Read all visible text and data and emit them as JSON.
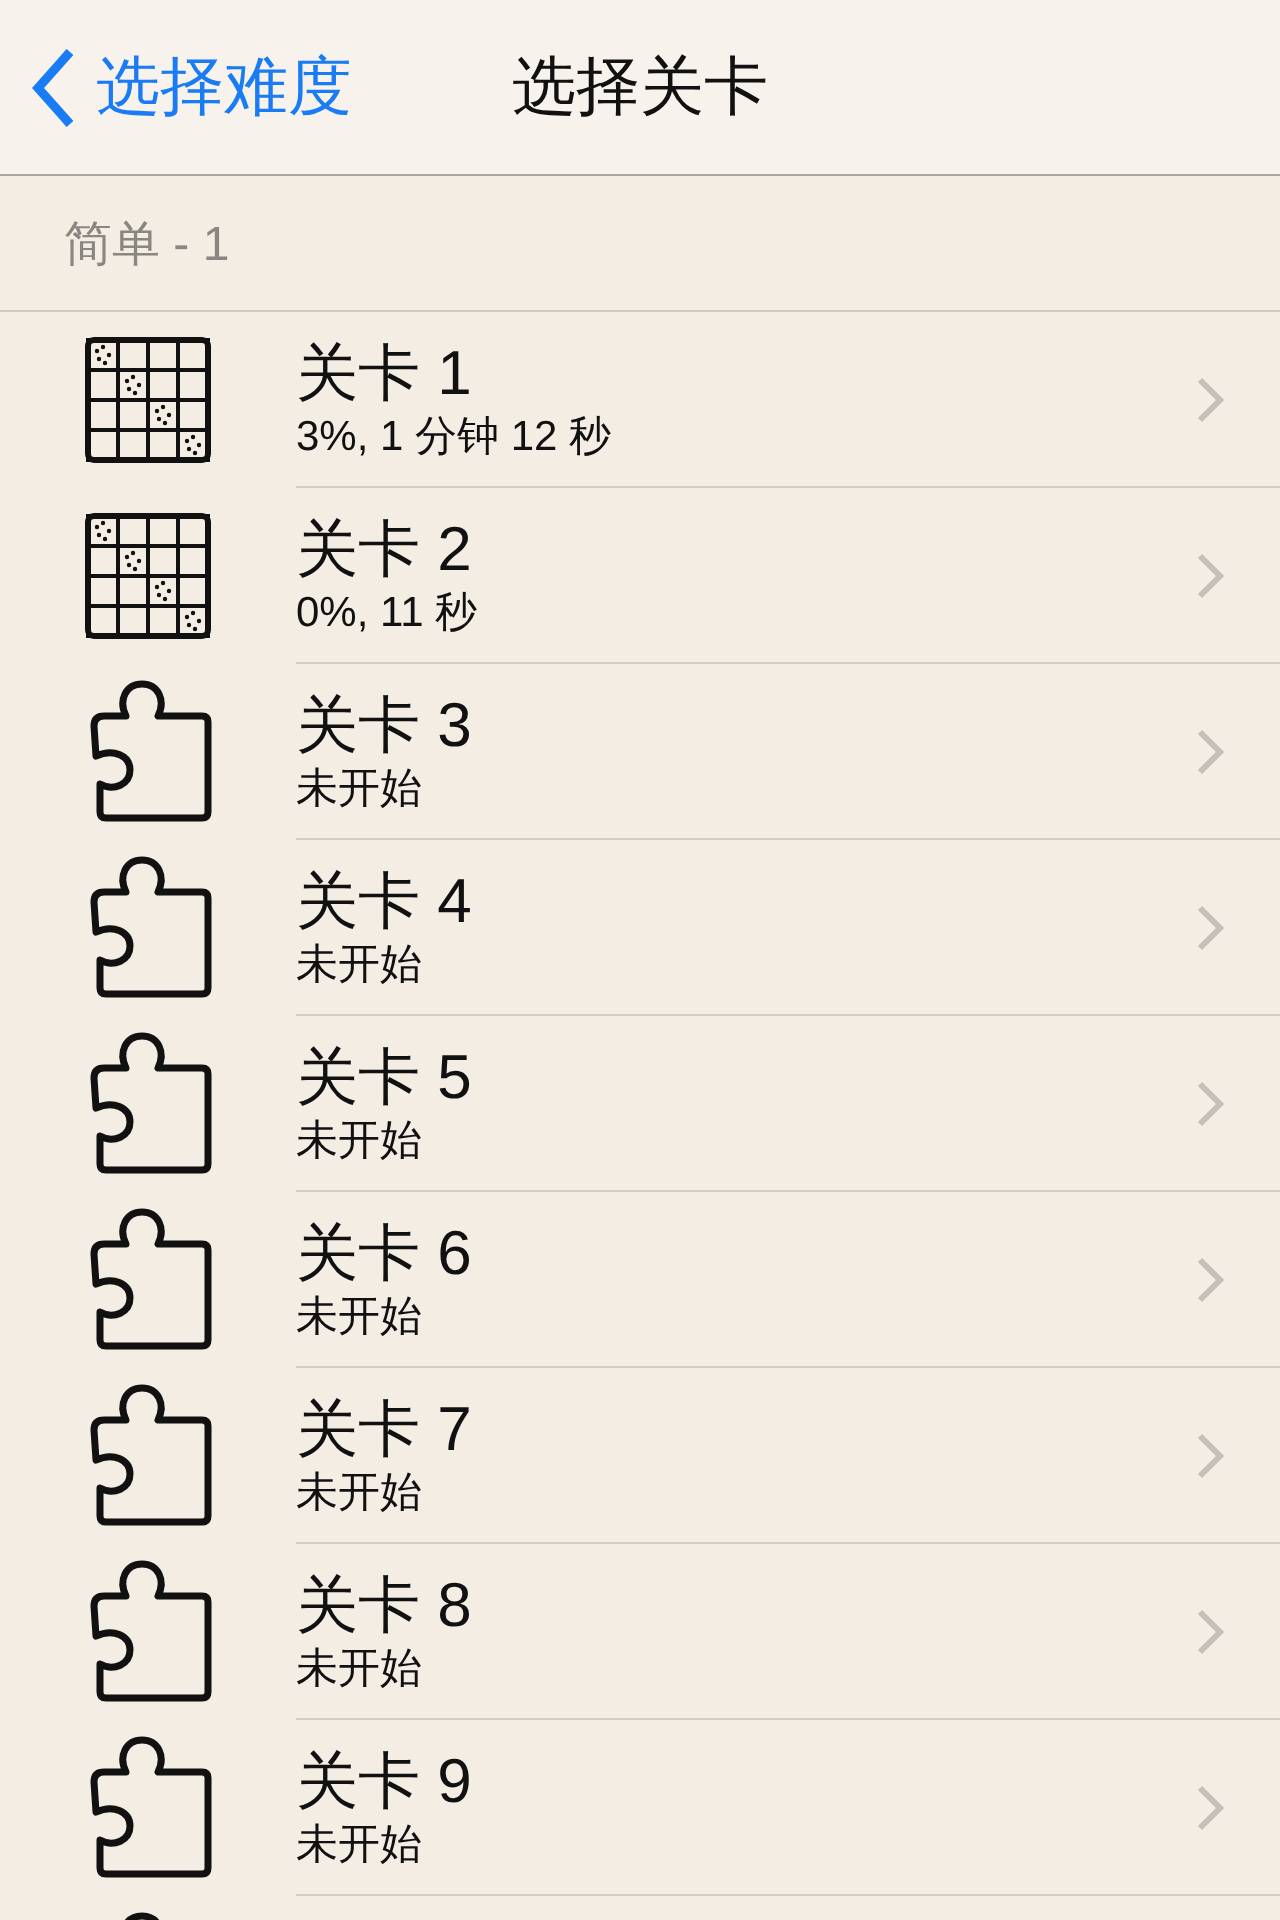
{
  "nav": {
    "back": "选择难度",
    "title": "选择关卡"
  },
  "section": "简单 - 1",
  "levels": [
    {
      "kind": "grid",
      "title": "关卡 1",
      "status": "3%, 1 分钟 12 秒"
    },
    {
      "kind": "grid",
      "title": "关卡 2",
      "status": "0%, 11 秒"
    },
    {
      "kind": "puzzle",
      "title": "关卡 3",
      "status": "未开始"
    },
    {
      "kind": "puzzle",
      "title": "关卡 4",
      "status": "未开始"
    },
    {
      "kind": "puzzle",
      "title": "关卡 5",
      "status": "未开始"
    },
    {
      "kind": "puzzle",
      "title": "关卡 6",
      "status": "未开始"
    },
    {
      "kind": "puzzle",
      "title": "关卡 7",
      "status": "未开始"
    },
    {
      "kind": "puzzle",
      "title": "关卡 8",
      "status": "未开始"
    },
    {
      "kind": "puzzle",
      "title": "关卡 9",
      "status": "未开始"
    },
    {
      "kind": "puzzle"
    }
  ]
}
